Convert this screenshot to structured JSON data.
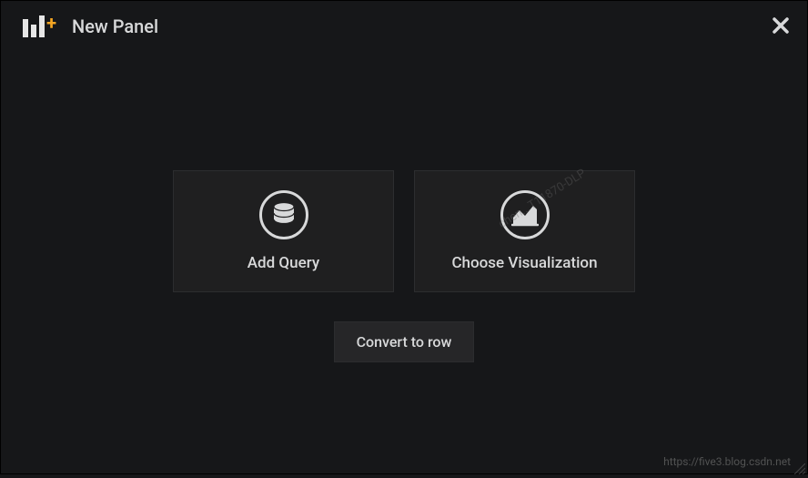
{
  "header": {
    "title": "New Panel"
  },
  "cards": {
    "add_query": "Add Query",
    "choose_visualization": "Choose Visualization"
  },
  "convert_button": "Convert to row",
  "watermark": {
    "bottom": "https://five3.blog.csdn.net",
    "diagonal": "chen...T11870-DLP"
  }
}
